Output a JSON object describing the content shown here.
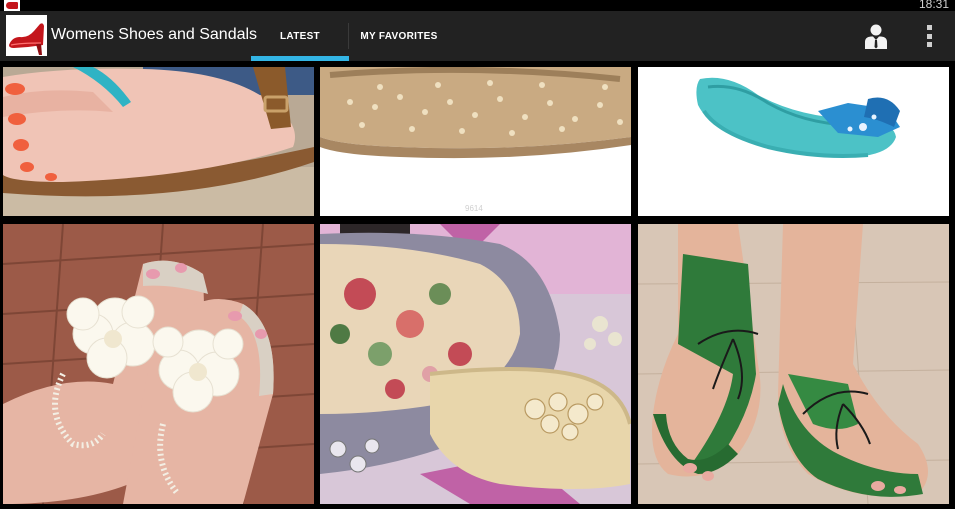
{
  "status_bar": {
    "time": "18:31",
    "app_icon": "red-high-heel-icon"
  },
  "action_bar": {
    "title": "Womens Shoes and Sandals",
    "logo_icon": "red-high-heel-icon",
    "tabs": [
      {
        "label": "LATEST",
        "selected": true
      },
      {
        "label": "MY FAVORITES",
        "selected": false
      }
    ],
    "actions": [
      {
        "icon": "profile-icon"
      },
      {
        "icon": "overflow-menu-icon"
      }
    ],
    "accent_color": "#33b5e5",
    "background_color": "#222222"
  },
  "grid": {
    "tiles": [
      {
        "subject": "flip-flop-sandal-with-pink-toenails"
      },
      {
        "subject": "studded-beige-ballet-flat",
        "caption": "9614"
      },
      {
        "subject": "turquoise-peep-toe-flat-with-bow"
      },
      {
        "subject": "white-flower-pearl-sandals-on-brick"
      },
      {
        "subject": "grey-and-floral-ballet-flats"
      },
      {
        "subject": "green-fringe-thong-sandals"
      }
    ]
  }
}
